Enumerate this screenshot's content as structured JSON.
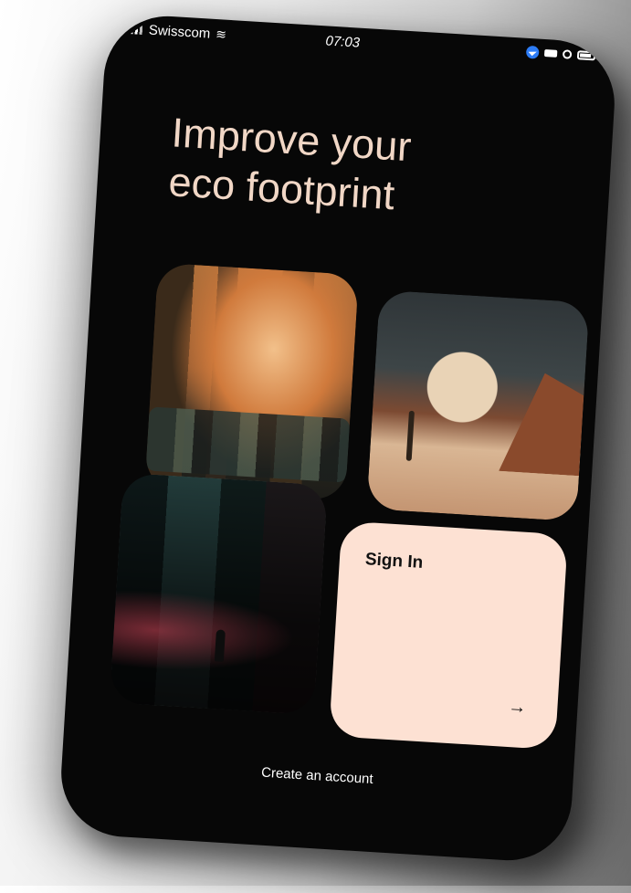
{
  "status_bar": {
    "carrier": "Swisscom",
    "time": "07:03"
  },
  "headline": "Improve your\neco footprint",
  "tiles": [
    {
      "name": "city-street-illustration"
    },
    {
      "name": "desert-moon-illustration"
    },
    {
      "name": "ruined-city-illustration"
    }
  ],
  "signin_card": {
    "label": "Sign In",
    "arrow": "→"
  },
  "create_account": "Create an account",
  "colors": {
    "headline": "#f1d7c6",
    "card": "#fde1d3",
    "phone_bg": "#070707",
    "location_icon": "#2d7cf6"
  }
}
